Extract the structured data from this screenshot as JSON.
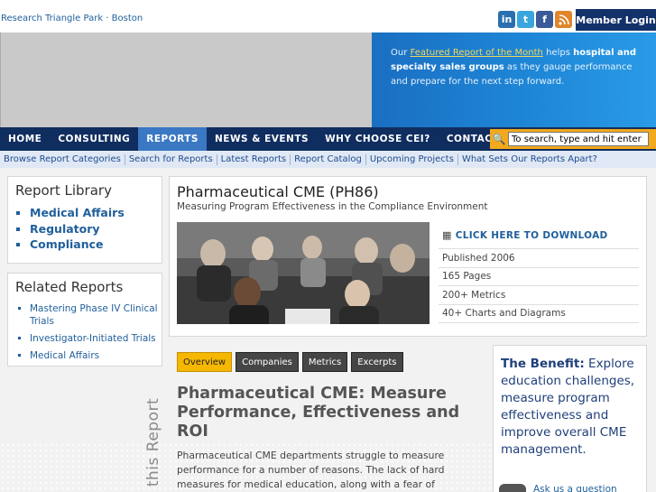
{
  "header": {
    "location": "Research Triangle Park · Boston",
    "social": [
      "in",
      "t",
      "f",
      "rss"
    ],
    "member_login": "Member Login"
  },
  "hero": {
    "text_prefix": "Our ",
    "link": "Featured Report of the Month",
    "text_middle": " helps ",
    "bold_segment": "hospital and specialty sales groups",
    "text_suffix": " as they gauge performance and prepare for the next step forward."
  },
  "nav": {
    "items": [
      "HOME",
      "CONSULTING",
      "REPORTS",
      "NEWS & EVENTS",
      "WHY CHOOSE CEI?",
      "CONTACT"
    ],
    "active": "REPORTS",
    "search_placeholder": "To search, type and hit enter"
  },
  "subnav": [
    "Browse Report Categories",
    "Search for Reports",
    "Latest Reports",
    "Report Catalog",
    "Upcoming Projects",
    "What Sets Our Reports Apart?"
  ],
  "sidebar": {
    "library_title": "Report Library",
    "library_items": [
      "Medical Affairs",
      "Regulatory",
      "Compliance"
    ],
    "related_title": "Related Reports",
    "related_items": [
      "Mastering Phase IV Clinical Trials",
      "Investigator-Initiated Trials",
      "Medical Affairs"
    ]
  },
  "report": {
    "title": "Pharmaceutical CME (PH86)",
    "subtitle": "Measuring Program Effectiveness in the Compliance Environment",
    "download_label": "CLICK HERE TO DOWNLOAD",
    "meta": [
      "Published 2006",
      "165 Pages",
      "200+ Metrics",
      "40+ Charts and Diagrams"
    ]
  },
  "tabs": [
    "Overview",
    "Companies",
    "Metrics",
    "Excerpts"
  ],
  "active_tab": "Overview",
  "vertical_label": "this Report",
  "article": {
    "title": "Pharmaceutical CME: Measure Performance, Effectiveness and ROI",
    "body": "Pharmaceutical CME departments struggle to measure performance for a number of reasons. The lack of hard measures for medical education, along with a fear of appearing"
  },
  "benefit": {
    "lead": "The Benefit:",
    "text": " Explore education challenges, measure program effectiveness and improve overall CME management.",
    "ask_label": "Ask us a question"
  },
  "colors": {
    "nav_bg": "#102d5f",
    "nav_active": "#3b78c3",
    "accent_orange": "#f2a91b",
    "link_blue": "#1f5f9b"
  }
}
